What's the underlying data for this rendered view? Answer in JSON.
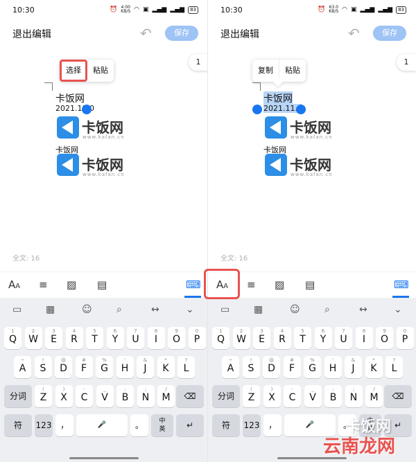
{
  "left": {
    "status": {
      "time": "10:30",
      "speed": "4.00",
      "speed_unit": "KB/S",
      "battery": "83"
    },
    "appbar": {
      "title": "退出编辑",
      "undo_icon": "undo-icon",
      "save": "保存"
    },
    "page_badge": "1",
    "popup": {
      "items": [
        "选择",
        "粘贴"
      ],
      "highlighted": "选择"
    },
    "doc": {
      "title": "卡饭网",
      "date": "2021.11.0",
      "line2": "卡饭网"
    },
    "logos": [
      {
        "text": "卡饭网",
        "url": "www.kafan.cn"
      },
      {
        "text": "卡饭网",
        "url": "www.kafan.cn"
      }
    ],
    "word_count": "全文: 16"
  },
  "right": {
    "status": {
      "time": "10:30",
      "speed": "63.0",
      "speed_unit": "KB/S",
      "battery": "83"
    },
    "appbar": {
      "title": "退出编辑",
      "undo_icon": "undo-icon",
      "save": "保存"
    },
    "page_badge": "1",
    "popup": {
      "items": [
        "复制",
        "粘贴"
      ]
    },
    "doc": {
      "title": "卡饭网",
      "date": "2021.11.0",
      "line2": "卡饭网"
    },
    "logos": [
      {
        "text": "卡饭网",
        "url": "www.kafan.cn"
      },
      {
        "text": "卡饭网",
        "url": "www.kafan.cn"
      }
    ],
    "word_count": "全文: 16"
  },
  "toolbar": {
    "icons": [
      "font-size-icon",
      "paragraph-icon",
      "image-icon",
      "checklist-icon",
      "keyboard-icon"
    ],
    "aa_label": "A",
    "aa_small": "A"
  },
  "keyboard": {
    "tools": [
      "clipboard-icon",
      "keyboard-layout-icon",
      "emoji-icon",
      "search-icon",
      "cursor-move-icon",
      "collapse-icon"
    ],
    "row1": [
      {
        "k": "Q",
        "s": "1"
      },
      {
        "k": "W",
        "s": "2"
      },
      {
        "k": "E",
        "s": "3"
      },
      {
        "k": "R",
        "s": "4"
      },
      {
        "k": "T",
        "s": "5"
      },
      {
        "k": "Y",
        "s": "6"
      },
      {
        "k": "U",
        "s": "7"
      },
      {
        "k": "I",
        "s": "8"
      },
      {
        "k": "O",
        "s": "9"
      },
      {
        "k": "P",
        "s": "0"
      }
    ],
    "row2": [
      {
        "k": "A",
        "s": "~"
      },
      {
        "k": "S",
        "s": "!"
      },
      {
        "k": "D",
        "s": "@"
      },
      {
        "k": "F",
        "s": "#"
      },
      {
        "k": "G",
        "s": "%"
      },
      {
        "k": "H",
        "s": "'"
      },
      {
        "k": "J",
        "s": "&"
      },
      {
        "k": "K",
        "s": "*"
      },
      {
        "k": "L",
        "s": "?"
      }
    ],
    "row3": [
      {
        "k": "Z",
        "s": "("
      },
      {
        "k": "X",
        "s": ")"
      },
      {
        "k": "C",
        "s": "-"
      },
      {
        "k": "V",
        "s": "_"
      },
      {
        "k": "B",
        "s": ":"
      },
      {
        "k": "N",
        "s": ";"
      },
      {
        "k": "M",
        "s": "/"
      }
    ],
    "fenci": "分词",
    "fu": "符",
    "num": "123",
    "comma": "，",
    "period": "。",
    "lang_top": "中",
    "lang_bottom": "英",
    "backspace_icon": "backspace-icon",
    "enter_icon": "enter-icon",
    "mic_icon": "mic-icon"
  },
  "watermark": {
    "top": "卡饭网",
    "bottom": "云南龙网"
  }
}
